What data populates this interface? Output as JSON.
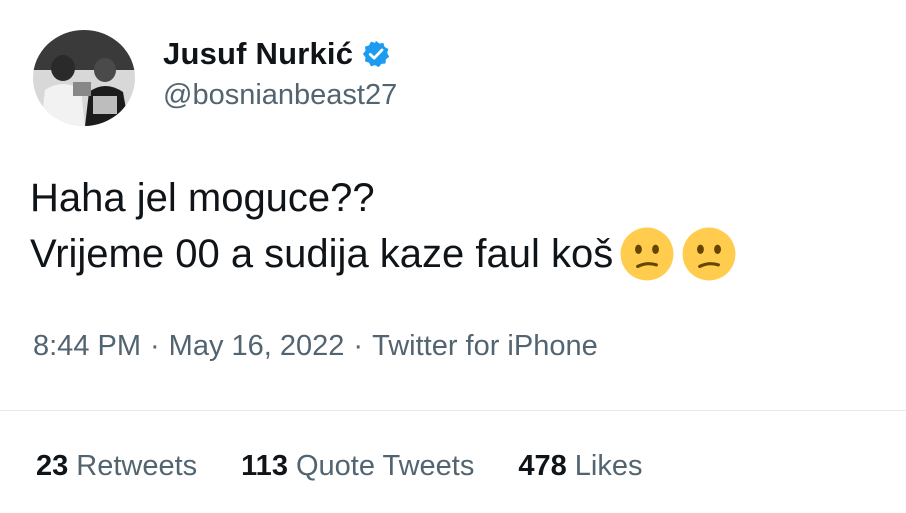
{
  "author": {
    "display_name": "Jusuf Nurkić",
    "handle": "@bosnianbeast27",
    "verified": true
  },
  "tweet": {
    "line1": "Haha jel moguce??",
    "line2": "Vrijeme 00 a sudija kaze faul koš",
    "emojis": [
      "confused-face-emoji",
      "confused-face-emoji"
    ]
  },
  "meta": {
    "time": "8:44 PM",
    "date": "May 16, 2022",
    "source": "Twitter for iPhone",
    "separator": "·"
  },
  "stats": {
    "retweets_count": "23",
    "retweets_label": "Retweets",
    "quotes_count": "113",
    "quotes_label": "Quote Tweets",
    "likes_count": "478",
    "likes_label": "Likes"
  },
  "colors": {
    "verified_blue": "#1d9bf0",
    "secondary_text": "#536471",
    "primary_text": "#0f1419",
    "emoji_yellow": "#ffcc4d"
  }
}
